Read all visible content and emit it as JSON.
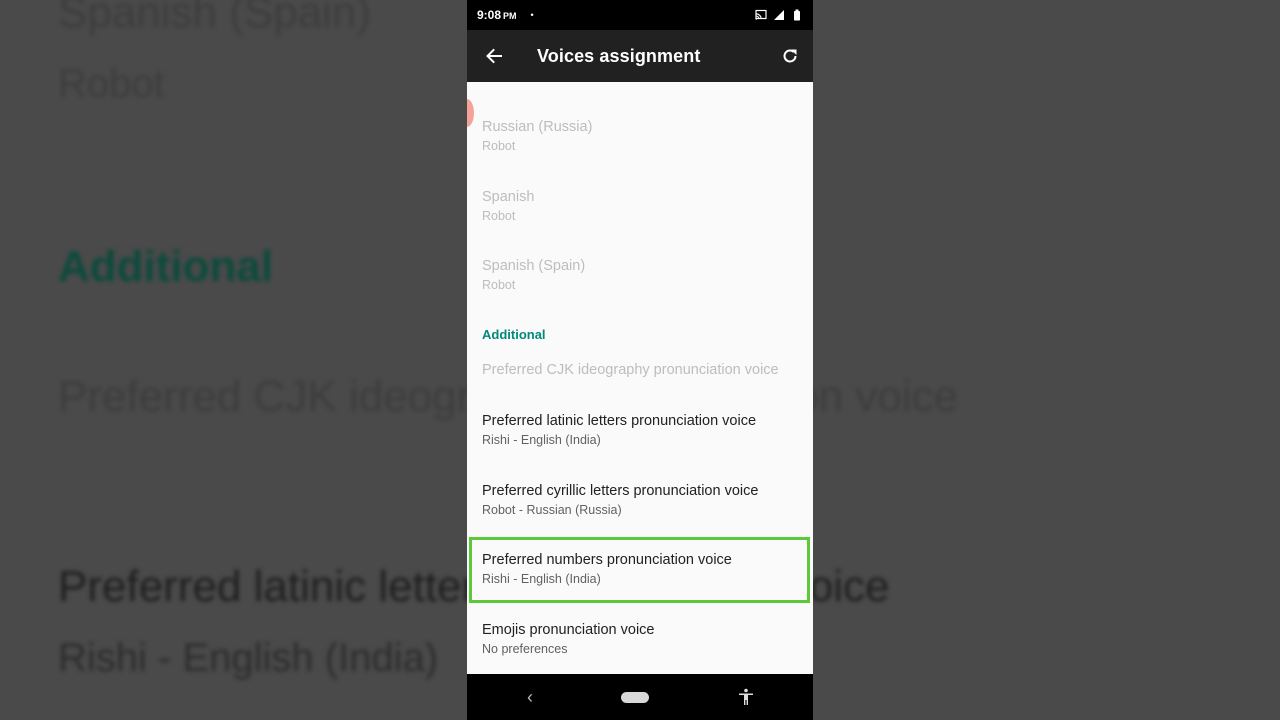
{
  "background": {
    "lines": [
      {
        "text": "Spanish (Spain)",
        "kind": "title-dim"
      },
      {
        "text": "Robot",
        "kind": "sub"
      },
      {
        "text": "Additional",
        "kind": "accent"
      },
      {
        "text": "Preferred CJK ideography pronunciation voice",
        "kind": "title-dim"
      },
      {
        "text": "Preferred latinic letters pronunciation voice",
        "kind": "title"
      },
      {
        "text": "Rishi - English (India)",
        "kind": "sub"
      }
    ]
  },
  "status_bar": {
    "time": "9:08",
    "ampm": "PM",
    "dot": "•",
    "icons": [
      "cast-icon",
      "signal-icon",
      "battery-icon"
    ]
  },
  "app_bar": {
    "title": "Voices assignment",
    "back_icon": "arrow-back-icon",
    "refresh_icon": "refresh-icon"
  },
  "list": {
    "items": [
      {
        "title": "Russian (Russia)",
        "subtitle": "Robot",
        "enabled": false
      },
      {
        "title": "Spanish",
        "subtitle": "Robot",
        "enabled": false
      },
      {
        "title": "Spanish (Spain)",
        "subtitle": "Robot",
        "enabled": false
      }
    ],
    "section_header": "Additional",
    "additional": [
      {
        "title": "Preferred CJK ideography pronunciation voice",
        "subtitle": "",
        "enabled": false
      },
      {
        "title": "Preferred latinic letters pronunciation voice",
        "subtitle": "Rishi - English (India)",
        "enabled": true
      },
      {
        "title": "Preferred cyrillic letters pronunciation voice",
        "subtitle": "Robot - Russian (Russia)",
        "enabled": true
      },
      {
        "title": "Preferred numbers pronunciation voice",
        "subtitle": "Rishi - English (India)",
        "enabled": true,
        "highlighted": true
      },
      {
        "title": "Emojis pronunciation voice",
        "subtitle": "No preferences",
        "enabled": true
      }
    ]
  },
  "nav_bar": {
    "back": "‹",
    "icons": [
      "nav-back-icon",
      "nav-home-icon",
      "accessibility-icon"
    ]
  },
  "colors": {
    "accent": "#00897b",
    "highlight": "#5cc83a",
    "app_bar": "#212121"
  }
}
